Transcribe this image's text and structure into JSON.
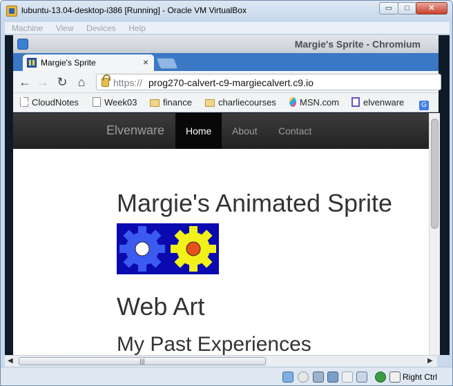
{
  "vbox": {
    "title": "lubuntu-13.04-desktop-i386 [Running] - Oracle VM VirtualBox",
    "menu": [
      "Machine",
      "View",
      "Devices",
      "Help"
    ],
    "min_glyph": "▭",
    "max_glyph": "□",
    "close_glyph": "✕"
  },
  "chromium": {
    "window_title": "Margie's Sprite - Chromium",
    "tab_title": "Margie's Sprite",
    "tab_close": "×",
    "url_scheme": "https://",
    "url_host": "prog270-calvert-c9-margiecalvert.c9.io",
    "nav_back": "←",
    "nav_forward": "→",
    "nav_reload": "↻",
    "nav_home": "⌂"
  },
  "bookmarks": [
    {
      "label": "CloudNotes",
      "icon": "page-icon"
    },
    {
      "label": "Week03",
      "icon": "page-icon"
    },
    {
      "label": "finance",
      "icon": "folder-icon"
    },
    {
      "label": "charliecourses",
      "icon": "folder-icon"
    },
    {
      "label": "MSN.com",
      "icon": "msn-icon"
    },
    {
      "label": "elvenware",
      "icon": "elvenware-icon"
    },
    {
      "label": "G",
      "icon": "google-icon"
    }
  ],
  "site": {
    "brand": "Elvenware",
    "nav": [
      "Home",
      "About",
      "Contact"
    ],
    "active_nav": "Home",
    "h1": "Margie's Animated Sprite",
    "h2": "Web Art",
    "h3": "My Past Experiences"
  },
  "status": {
    "host_key": "Right Ctrl"
  },
  "colors": {
    "navbar": "#222222",
    "sprite_bg": "#0a0ab0",
    "gear_blue": "#3b5bf0",
    "gear_yellow": "#f2f21a",
    "gear_orange": "#e8501b"
  }
}
